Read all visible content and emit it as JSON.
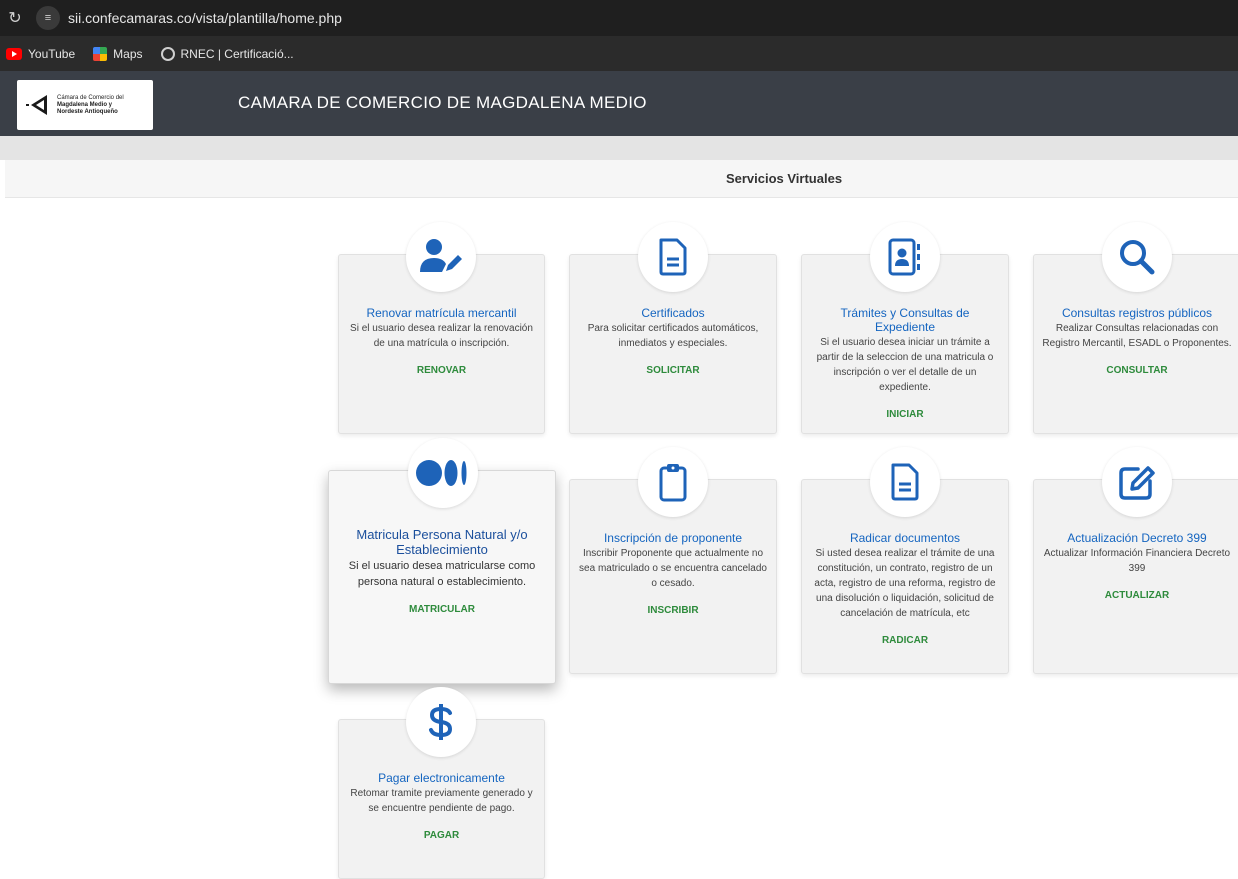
{
  "browser": {
    "url": "sii.confecamaras.co/vista/plantilla/home.php",
    "bookmarks": [
      {
        "label": "YouTube",
        "icon": "youtube-icon"
      },
      {
        "label": "Maps",
        "icon": "maps-icon"
      },
      {
        "label": "RNEC | Certificació...",
        "icon": "globe-icon"
      }
    ]
  },
  "header": {
    "logo_line1": "Cámara de Comercio del",
    "logo_line2": "Magdalena Medio y",
    "logo_line3": "Nordeste Antioqueño",
    "title": "CAMARA DE COMERCIO DE MAGDALENA MEDIO"
  },
  "services": {
    "title": "Servicios Virtuales",
    "accent_color": "#2e8b3c",
    "title_color": "#1565c0",
    "cards": [
      {
        "title": "Renovar matrícula mercantil",
        "desc": "Si el usuario desea realizar la renovación de una matrícula o inscripción.",
        "action": "RENOVAR",
        "icon": "user-edit-icon"
      },
      {
        "title": "Certificados",
        "desc": "Para solicitar certificados automáticos, inmediatos y especiales.",
        "action": "SOLICITAR",
        "icon": "file-icon"
      },
      {
        "title": "Trámites y Consultas de Expediente",
        "desc": "Si el usuario desea iniciar un trámite a partir de la seleccion de una matricula o inscripción o ver el detalle de un expediente.",
        "action": "INICIAR",
        "icon": "address-book-icon"
      },
      {
        "title": "Consultas registros públicos",
        "desc": "Realizar Consultas relacionadas con Registro Mercantil, ESADL o Proponentes.",
        "action": "CONSULTAR",
        "icon": "search-icon"
      },
      {
        "title": "Matricula Persona Natural y/o Establecimiento",
        "desc": "Si el usuario desea matricularse como persona natural o establecimiento.",
        "action": "MATRICULAR",
        "icon": "medium-icon"
      },
      {
        "title": "Inscripción de proponente",
        "desc": "Inscribir Proponente que actualmente no sea matriculado o se encuentra cancelado o cesado.",
        "action": "INSCRIBIR",
        "icon": "clipboard-icon"
      },
      {
        "title": "Radicar documentos",
        "desc": "Si usted desea realizar el trámite de una constitución, un contrato, registro de un acta, registro de una reforma, registro de una disolución o liquidación, solicitud de cancelación de matrícula, etc",
        "action": "RADICAR",
        "icon": "file-icon"
      },
      {
        "title": "Actualización Decreto 399",
        "desc": "Actualizar Información Financiera Decreto 399",
        "action": "ACTUALIZAR",
        "icon": "edit-icon"
      },
      {
        "title": "Pagar electronicamente",
        "desc": "Retomar tramite previamente generado y se encuentre pendiente de pago.",
        "action": "PAGAR",
        "icon": "dollar-icon"
      }
    ]
  }
}
